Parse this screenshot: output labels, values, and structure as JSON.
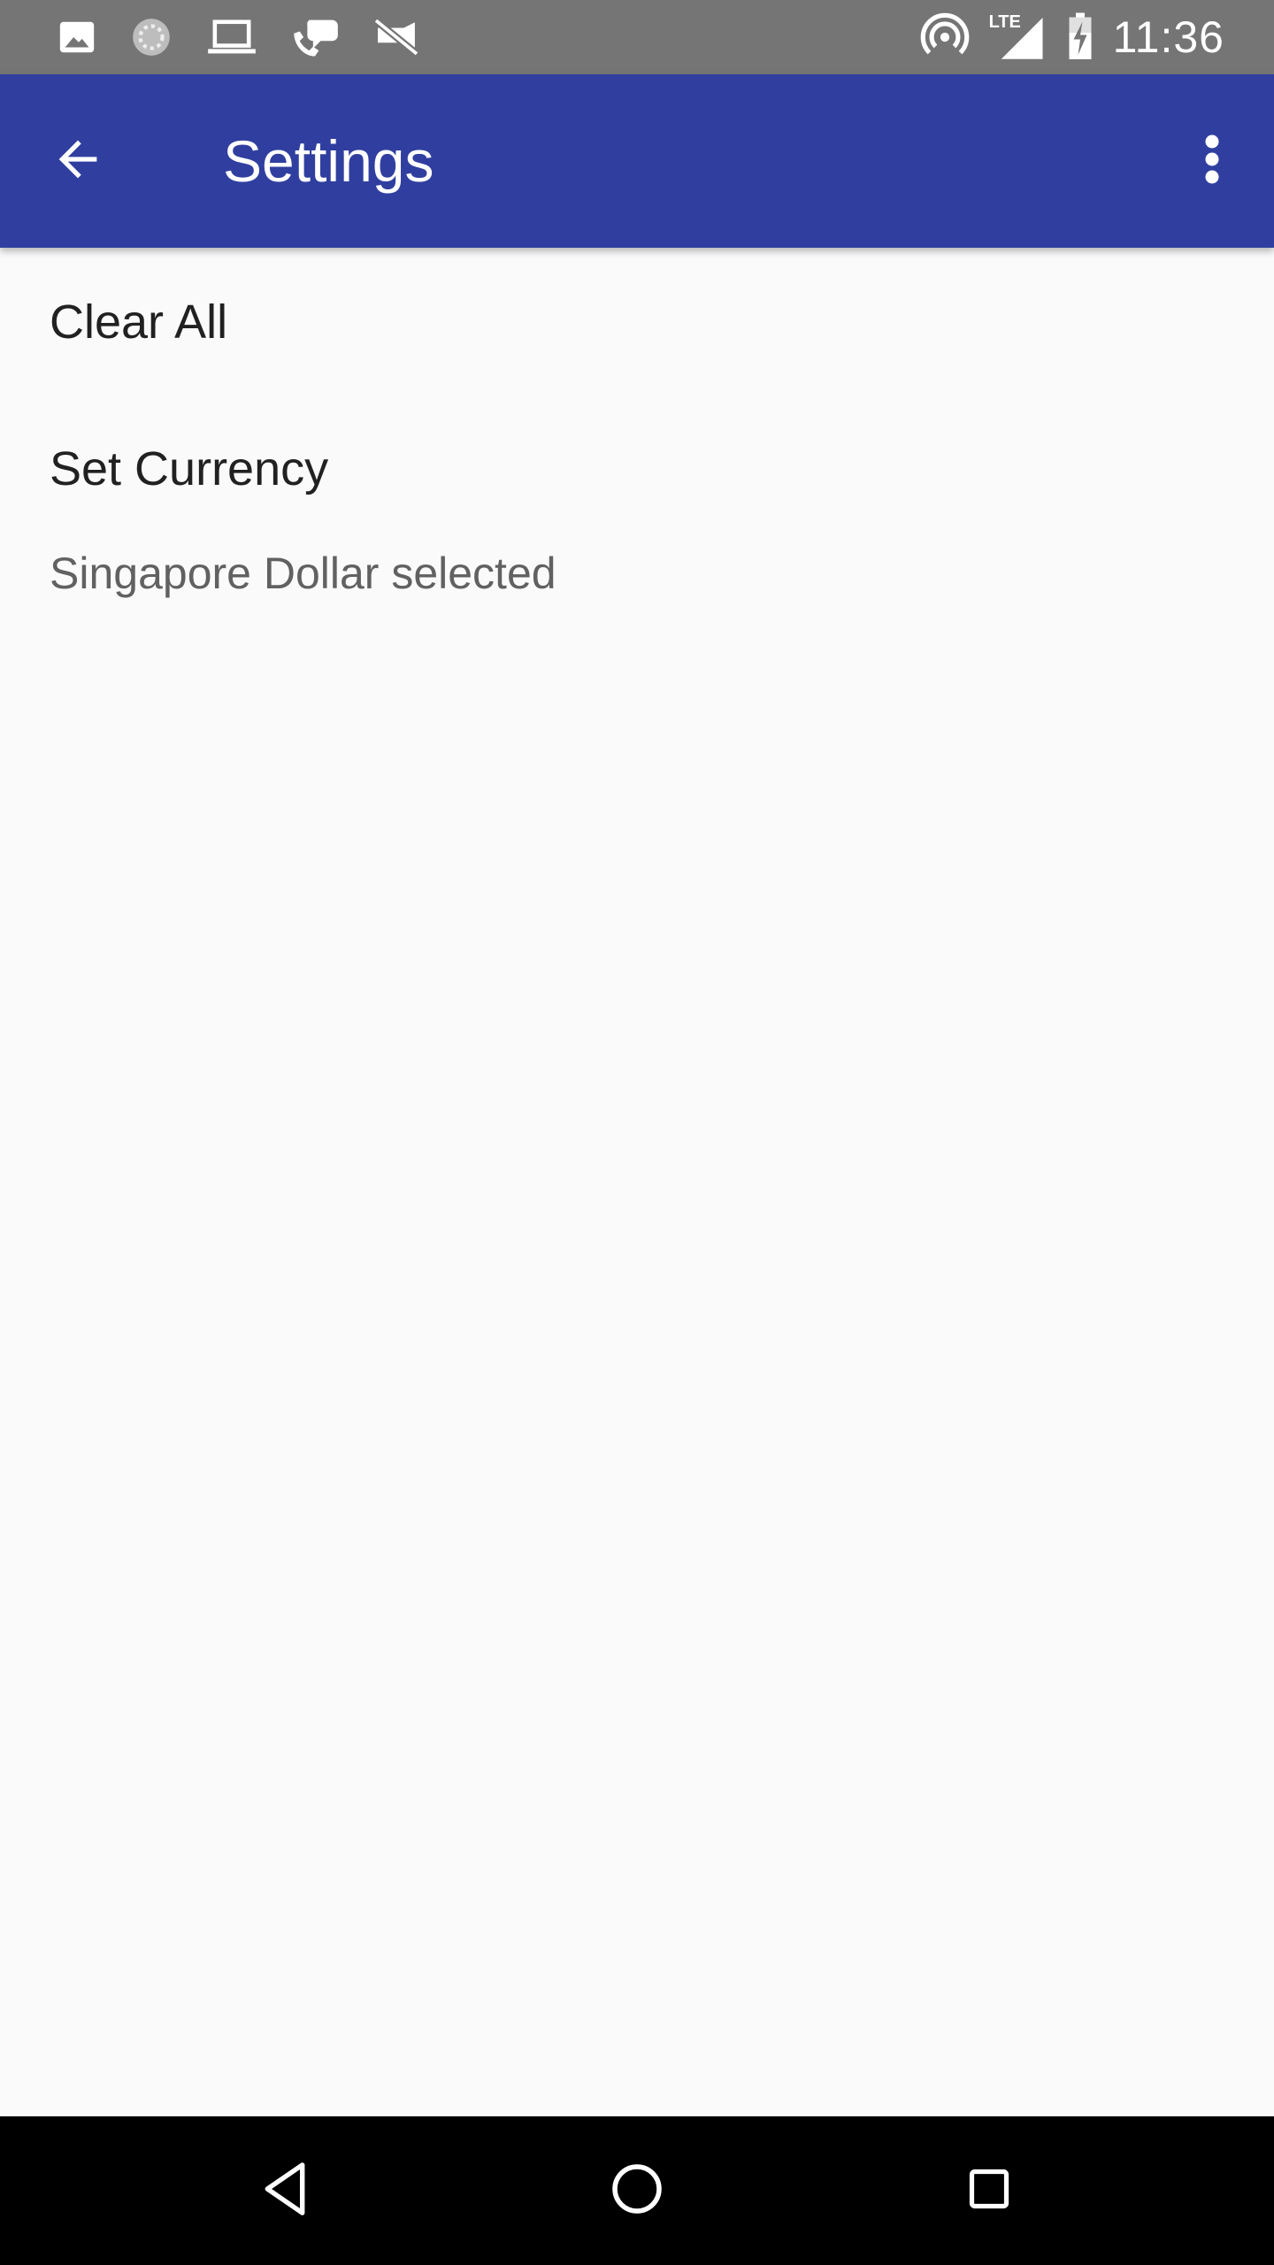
{
  "status_bar": {
    "time": "11:36",
    "network_label": "LTE",
    "left_icons": [
      "image-icon",
      "sync-icon",
      "laptop-icon",
      "chat-icon",
      "no-camera-icon"
    ],
    "right_icons": [
      "hotspot-icon",
      "signal-icon",
      "battery-charging-icon"
    ]
  },
  "app_bar": {
    "title": "Settings",
    "color": "#303f9f"
  },
  "preferences": [
    {
      "title": "Clear All",
      "summary": ""
    },
    {
      "title": "Set Currency",
      "summary": "Singapore Dollar selected"
    }
  ],
  "nav_bar": {
    "buttons": [
      "back-icon",
      "home-icon",
      "recents-icon"
    ]
  }
}
